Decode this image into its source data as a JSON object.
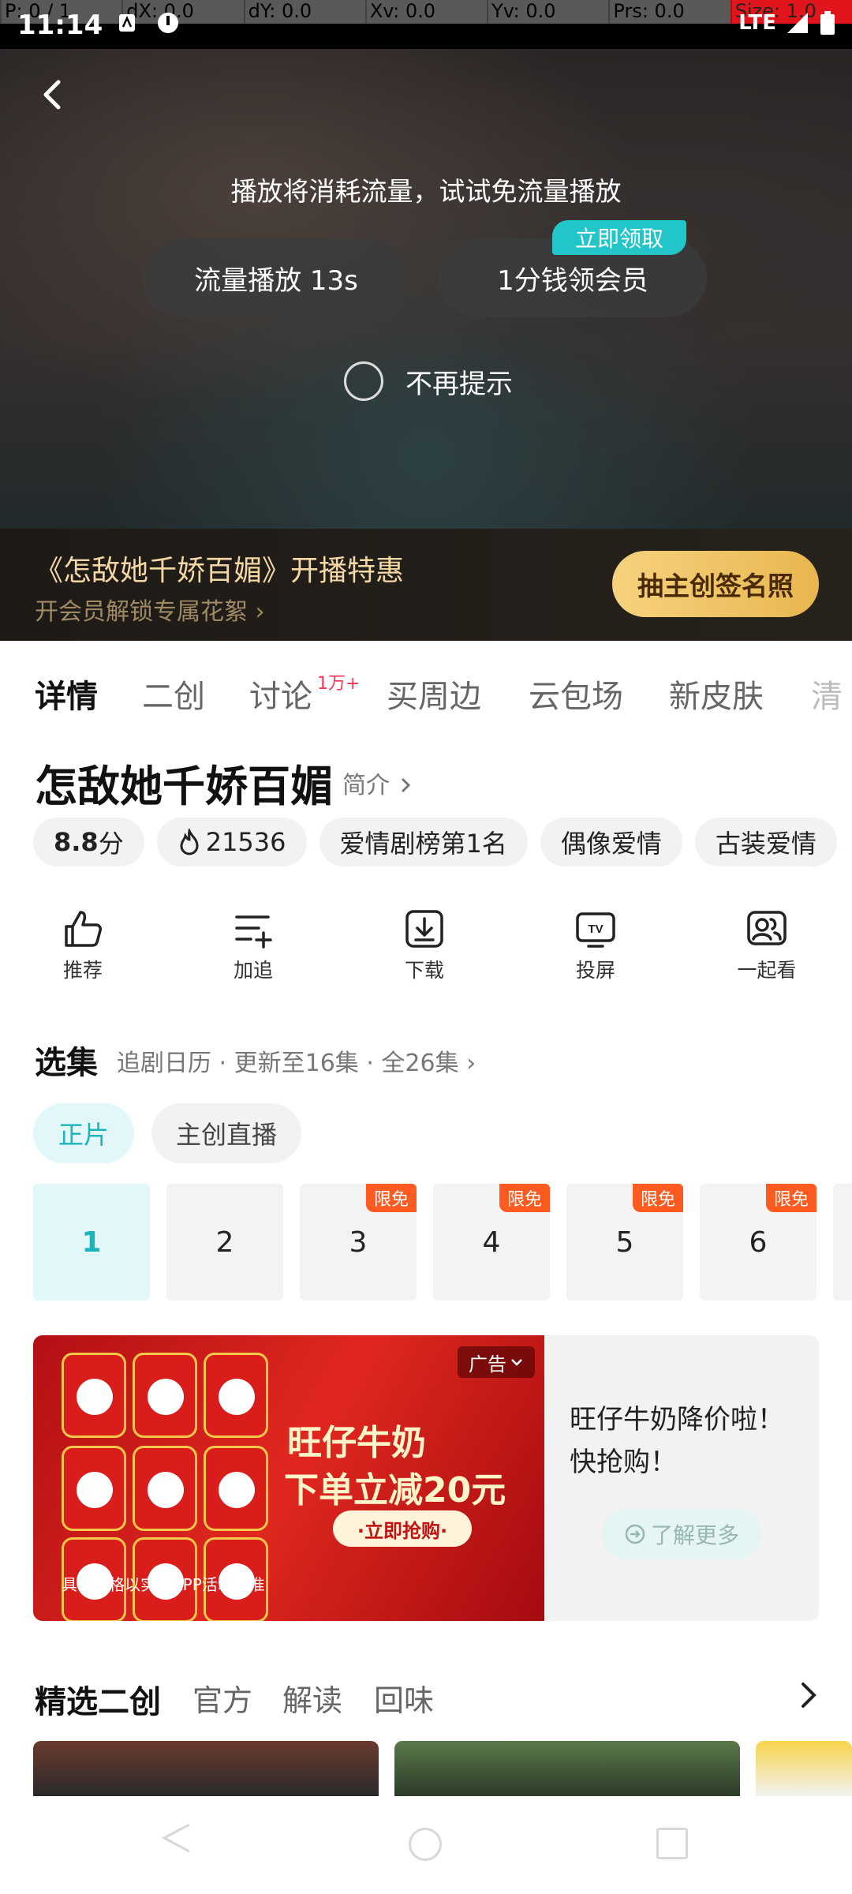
{
  "status_bar": {
    "time": "11:14",
    "network": "LTE",
    "debug": [
      "P: 0 / 1",
      "dX: 0.0",
      "dY: 0.0",
      "Xv: 0.0",
      "Yv: 0.0",
      "Prs: 0.0",
      "Size: 1.0"
    ]
  },
  "player": {
    "prompt": "播放将消耗流量，试试免流量播放",
    "data_play_label": "流量播放 13s",
    "vip_label": "1分钱领会员",
    "claim_tag": "立即领取",
    "no_remind_label": "不再提示"
  },
  "promo": {
    "title": "《怎敌她千娇百媚》开播特惠",
    "subtitle": "开会员解锁专属花絮 ›",
    "button": "抽主创签名照"
  },
  "tabs": {
    "items": [
      "详情",
      "二创",
      "讨论",
      "买周边",
      "云包场",
      "新皮肤",
      "清"
    ],
    "discussion_badge": "1万+"
  },
  "show": {
    "title": "怎敌她千娇百媚",
    "intro_link": "简介",
    "rating": "8.8",
    "rating_unit": "分",
    "heat": "21536",
    "tags": [
      "爱情剧榜第1名",
      "偶像爱情",
      "古装爱情"
    ]
  },
  "actions": {
    "recommend": "推荐",
    "follow": "加追",
    "download": "下载",
    "cast": "投屏",
    "watch_together": "一起看"
  },
  "episodes": {
    "title": "选集",
    "info": "追剧日历 · 更新至16集 · 全26集 ›",
    "tab_main": "正片",
    "tab_live": "主创直播",
    "free_badge": "限免",
    "list": [
      "1",
      "2",
      "3",
      "4",
      "5",
      "6"
    ],
    "selected": "1"
  },
  "ad": {
    "tag": "广告",
    "headline_1": "旺仔牛奶",
    "headline_2": "下单立减20元",
    "buy_label": "·立即抢购·",
    "disclaimer": "具体价格以实际APP活动为准",
    "text": "旺仔牛奶降价啦！快抢购！",
    "more_label": "了解更多"
  },
  "featured": {
    "title": "精选二创",
    "tabs": [
      "官方",
      "解读",
      "回味"
    ]
  },
  "colors": {
    "accent": "#1bb4bb",
    "promo_gold": "#f3d8a6",
    "free_badge": "#ff5a1f"
  }
}
